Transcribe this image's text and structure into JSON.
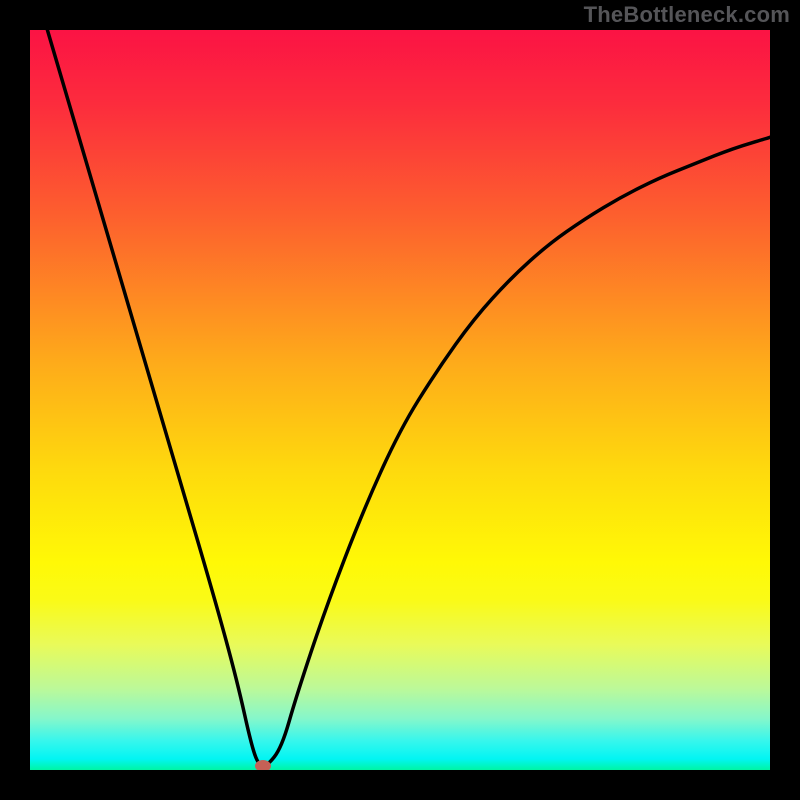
{
  "watermark": "TheBottleneck.com",
  "chart_data": {
    "type": "line",
    "title": "",
    "xlabel": "",
    "ylabel": "",
    "xlim": [
      0,
      100
    ],
    "ylim": [
      0,
      100
    ],
    "grid": false,
    "legend": false,
    "series": [
      {
        "name": "bottleneck-curve",
        "x": [
          0,
          5,
          10,
          15,
          20,
          25,
          28,
          30,
          31,
          32,
          34,
          36,
          40,
          45,
          50,
          55,
          60,
          65,
          70,
          75,
          80,
          85,
          90,
          95,
          100
        ],
        "values": [
          108,
          91,
          74,
          57,
          40,
          23,
          12,
          3,
          0.5,
          0.5,
          3,
          10,
          22,
          35,
          46,
          54,
          61,
          66.5,
          71,
          74.5,
          77.5,
          80,
          82,
          84,
          85.5
        ]
      }
    ],
    "annotations": [
      {
        "type": "marker",
        "x": 31.5,
        "y": 0.5,
        "label": "optimal-point"
      }
    ]
  },
  "colors": {
    "background": "#000000",
    "curve": "#000000",
    "marker": "#c56156"
  }
}
